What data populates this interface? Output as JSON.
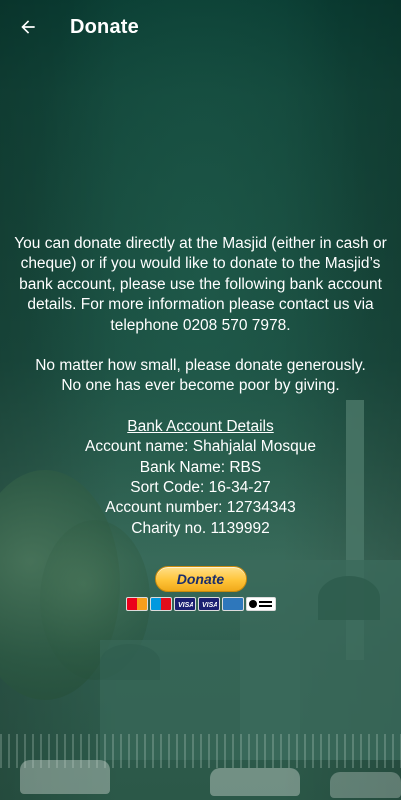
{
  "app_bar": {
    "title": "Donate",
    "back_icon": "arrow-left-icon"
  },
  "content": {
    "intro": "You can donate directly at the Masjid (either in cash or cheque) or if you would like to donate to the Masjid’s bank account, please use the following bank account details. For more information please contact us via telephone 0208 570 7978.",
    "appeal_line_1": "No matter how small, please donate generously.",
    "appeal_line_2": "No one has ever become poor by giving.",
    "bank": {
      "header": "Bank Account Details",
      "account_name": "Account name: Shahjalal Mosque",
      "bank_name": "Bank Name: RBS",
      "sort_code": "Sort Code: 16-34-27",
      "account_number": "Account number: 12734343",
      "charity_no": "Charity no. 1139992"
    }
  },
  "donate": {
    "button_label": "Donate",
    "payment_icons": [
      "mastercard-icon",
      "maestro-icon",
      "visa-icon",
      "visa-electron-icon",
      "amex-icon",
      "direct-debit-icon"
    ]
  },
  "colors": {
    "background_top": "#0a3d33",
    "paypal_yellow": "#ffc439",
    "paypal_text": "#1b2e6b",
    "text": "#ffffff"
  }
}
